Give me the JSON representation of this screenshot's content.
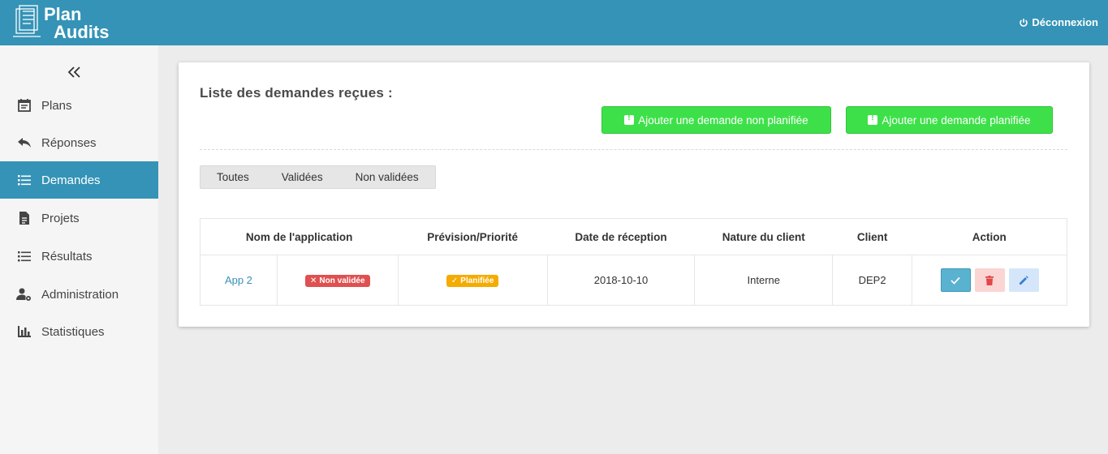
{
  "header": {
    "logo_line1": "Plan",
    "logo_line2": "Audits",
    "logout_label": "Déconnexion"
  },
  "sidebar": {
    "items": [
      {
        "label": "Plans",
        "icon": "calendar-icon"
      },
      {
        "label": "Réponses",
        "icon": "reply-icon"
      },
      {
        "label": "Demandes",
        "icon": "list-icon",
        "active": true
      },
      {
        "label": "Projets",
        "icon": "document-icon"
      },
      {
        "label": "Résultats",
        "icon": "list-icon"
      },
      {
        "label": "Administration",
        "icon": "user-settings-icon"
      },
      {
        "label": "Statistiques",
        "icon": "bar-chart-icon"
      }
    ]
  },
  "main": {
    "title": "Liste des demandes reçues :",
    "add_unplanned_label": "Ajouter une demande non planifiée",
    "add_planned_label": "Ajouter une demande planifiée",
    "filters": [
      "Toutes",
      "Validées",
      "Non validées"
    ],
    "table": {
      "columns": [
        "Nom de l'application",
        "",
        "Prévision/Priorité",
        "Date de réception",
        "Nature du client",
        "Client",
        "Action"
      ],
      "rows": [
        {
          "app": "App 2",
          "status": "Non validée",
          "planning": "Planifiée",
          "date": "2018-10-10",
          "nature": "Interne",
          "client": "DEP2"
        }
      ]
    }
  },
  "colors": {
    "topbar": "#3493b6",
    "accent_green": "#3ee04a",
    "badge_red": "#e05050",
    "badge_orange": "#f5ab00"
  }
}
